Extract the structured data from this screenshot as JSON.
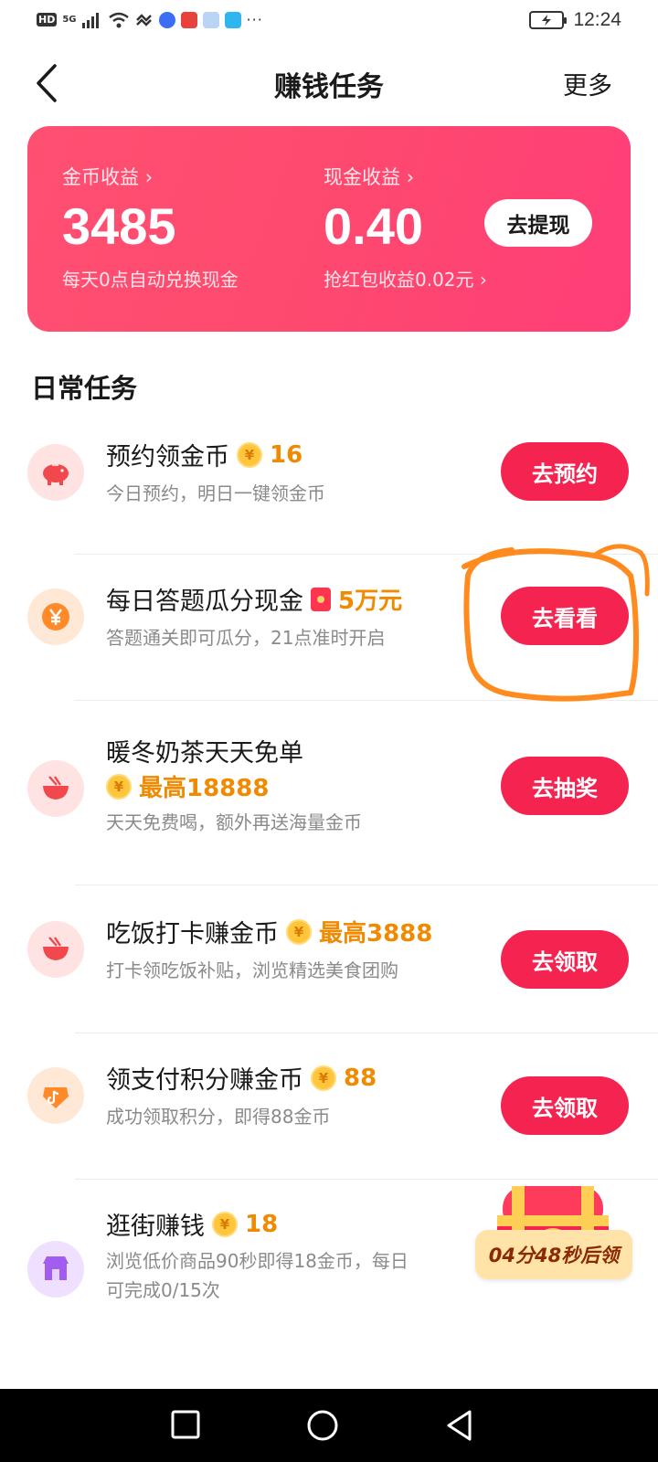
{
  "status_bar": {
    "hd": "HD",
    "network": "5G",
    "dots": "···",
    "time": "12:24"
  },
  "header": {
    "title": "赚钱任务",
    "more": "更多"
  },
  "earnings": {
    "coin_label": "金币收益",
    "coin_value": "3485",
    "coin_note": "每天0点自动兑换现金",
    "cash_label": "现金收益",
    "cash_value": "0.40",
    "cash_note": "抢红包收益0.02元",
    "withdraw_label": "去提现",
    "chevron": "›"
  },
  "section": {
    "title": "日常任务"
  },
  "tasks": [
    {
      "title": "预约领金币",
      "reward": "16",
      "desc": "今日预约，明日一键领金币",
      "button": "去预约",
      "icon": "piggy-bank-icon"
    },
    {
      "title": "每日答题瓜分现金",
      "reward": "5万元",
      "desc": "答题通关即可瓜分，21点准时开启",
      "button": "去看看",
      "icon": "yuan-coin-icon"
    },
    {
      "title": "暖冬奶茶天天免单",
      "reward": "最高18888",
      "desc": "天天免费喝，额外再送海量金币",
      "button": "去抽奖",
      "icon": "bowl-icon"
    },
    {
      "title": "吃饭打卡赚金币",
      "reward": "最高3888",
      "desc": "打卡领吃饭补贴，浏览精选美食团购",
      "button": "去领取",
      "icon": "bowl-icon"
    },
    {
      "title": "领支付积分赚金币",
      "reward": "88",
      "desc": "成功领取积分，即得88金币",
      "button": "去领取",
      "icon": "tiktok-diamond-icon"
    },
    {
      "title": "逛街赚钱",
      "reward": "18",
      "desc": "浏览低价商品90秒即得18金币，每日",
      "desc2": "可完成0/15次",
      "icon": "shop-icon"
    }
  ],
  "coin_symbol": "¥",
  "treasure": {
    "timer": "04分48秒后领"
  },
  "colors": {
    "accent": "#f42350",
    "card_start": "#ff5072",
    "card_end": "#ff3e78",
    "reward": "#f08a00",
    "annotation": "#ff8a1e"
  }
}
